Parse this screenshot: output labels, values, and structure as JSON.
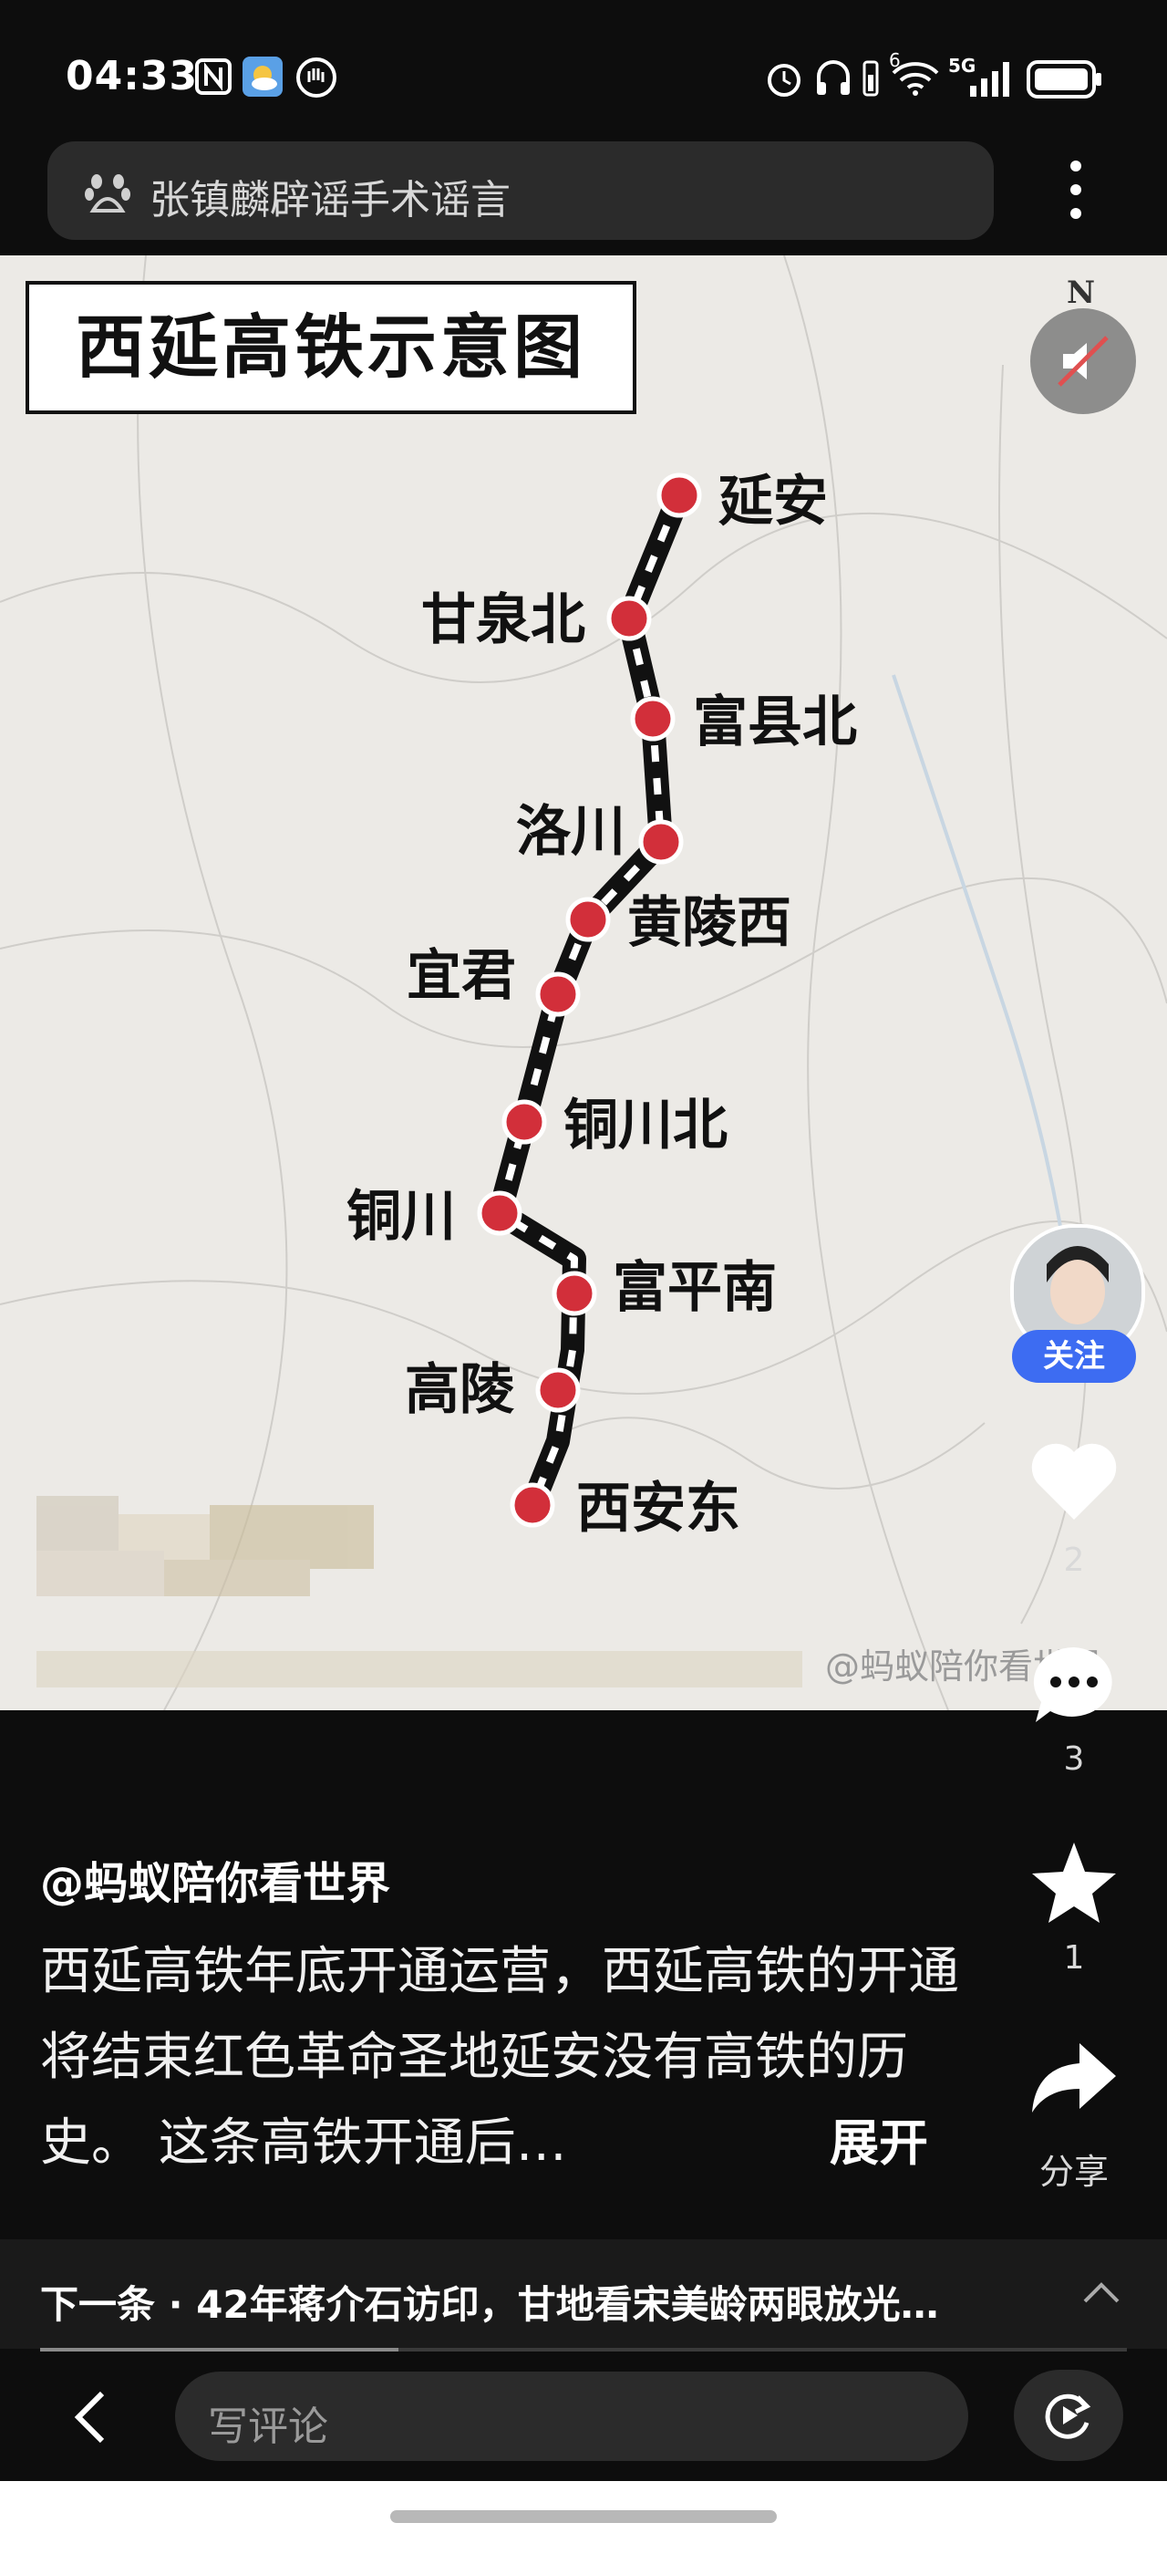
{
  "status_bar": {
    "time": "04:33",
    "network": "5G",
    "signal_label": "6"
  },
  "search": {
    "text": "张镇麟辟谣手术谣言"
  },
  "map": {
    "title": "西延高铁示意图",
    "watermark": "@蚂蚁陪你看世界",
    "compass": "N",
    "stations": [
      "延安",
      "甘泉北",
      "富县北",
      "洛川",
      "黄陵西",
      "宜君",
      "铜川北",
      "铜川",
      "富平南",
      "高陵",
      "西安东"
    ]
  },
  "rail": {
    "follow_label": "关注",
    "like_count": "2",
    "comment_count": "3",
    "favorite_count": "1",
    "share_label": "分享"
  },
  "post": {
    "author": "@蚂蚁陪你看世界",
    "description": "西延高铁年底开通运营，西延高铁的开通将结束红色革命圣地延安没有高铁的历史。 这条高铁开通后…",
    "expand": "展开"
  },
  "next": {
    "text": "下一条 · 42年蒋介石访印，甘地看宋美龄两眼放光…"
  },
  "progress": {
    "fraction": 0.33
  },
  "bottom": {
    "comment_placeholder": "写评论"
  },
  "colors": {
    "station_red": "#d22f3a",
    "follow_blue": "#3d6cf2"
  }
}
